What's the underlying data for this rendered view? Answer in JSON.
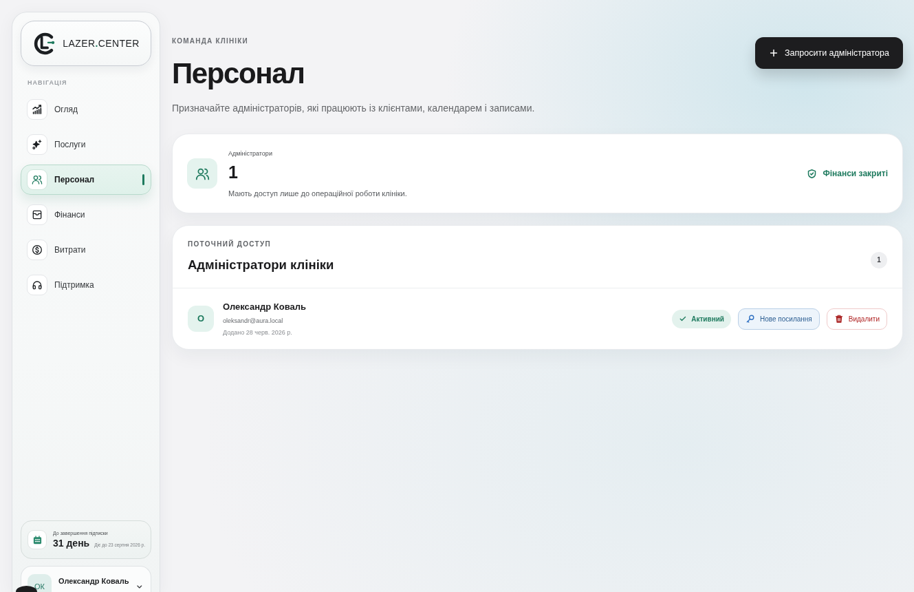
{
  "sidebar": {
    "brand": {
      "parts": [
        {
          "text": "LAZER",
          "accent": false
        },
        {
          "text": ".",
          "accent": true
        },
        {
          "text": "CENTER",
          "accent": false
        }
      ]
    },
    "nav_heading": "НАВІГАЦІЯ",
    "items": [
      {
        "label": "Огляд",
        "selected": false
      },
      {
        "label": "Послуги",
        "selected": false
      },
      {
        "label": "Персонал",
        "selected": true
      },
      {
        "label": "Фінанси",
        "selected": false
      },
      {
        "label": "Витрати",
        "selected": false
      },
      {
        "label": "Підтримка",
        "selected": false
      }
    ],
    "subscription": {
      "label": "До завершення підписки",
      "days": "31 день",
      "valid_until": "Діє до 23 серпня 2026 р."
    },
    "user": {
      "initials": "ОК",
      "name": "Олександр Коваль"
    }
  },
  "header": {
    "eyebrow": "КОМАНДА КЛІНІКИ",
    "title": "Персонал",
    "subtitle": "Призначайте адміністраторів, які працюють із клієнтами, календарем і записами.",
    "invite_button": "Запросити адміністратора"
  },
  "summary": {
    "label": "Адміністратори",
    "value": "1",
    "note": "Мають доступ лише до операційної роботи клініки.",
    "finance_status": "Фінанси закриті"
  },
  "admins": {
    "eyebrow": "ПОТОЧНИЙ ДОСТУП",
    "title": "Адміністратори клініки",
    "count": "1",
    "rows": [
      {
        "initial": "О",
        "name": "Олександр Коваль",
        "email": "oleksandr@aura.local",
        "added": "Додано 28 черв. 2026 р.",
        "status": {
          "label": "Активний",
          "active": true
        },
        "actions": [
          {
            "kind": "link",
            "label": "Нове посилання"
          },
          {
            "kind": "delete",
            "label": "Видалити"
          }
        ]
      }
    ]
  }
}
